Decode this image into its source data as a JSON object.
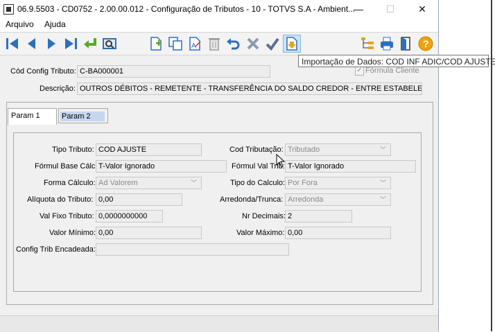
{
  "window": {
    "title": "06.9.5503 - CD0752 - 2.00.00.012 - Configuração de Tributos - 10 - TOTVS S.A - Ambient...",
    "min_symbol": "—",
    "max_symbol": "☐",
    "close_symbol": "✕"
  },
  "menu": {
    "items": [
      "Arquivo",
      "Ajuda"
    ]
  },
  "toolbar": {
    "icons": [
      "first-icon",
      "prev-icon",
      "next-icon",
      "last-icon",
      "goto-icon",
      "search-icon",
      "new-icon",
      "copy-icon",
      "edit-icon",
      "delete-icon",
      "undo-icon",
      "cancel-icon",
      "save-icon",
      "import-icon",
      "tree-icon",
      "print-icon",
      "exit-icon",
      "help-icon"
    ],
    "tooltip": "Importação de Dados: COD INF ADIC/COD AJUSTE"
  },
  "header": {
    "cod_label": "Cód Config Tributo:",
    "cod_value": "C-BA000001",
    "formula_label": "Fórmula Cliente",
    "desc_label": "Descrição:",
    "desc_value": "OUTROS DÉBITOS - REMETENTE - TRANSFERÊNCIA DO SALDO CREDOR - ENTRE ESTABELECIMENTOS"
  },
  "tabs": [
    "Param 1",
    "Param 2"
  ],
  "form": {
    "tipo_tributo_label": "Tipo Tributo:",
    "tipo_tributo_value": "COD AJUSTE",
    "cod_trib_label": "Cod Tributação:",
    "cod_trib_value": "Tributado",
    "form_base_label": "Fórmul Base Cálc:",
    "form_base_value": "T-Valor Ignorado",
    "form_val_label": "Fórmul Val Trib:",
    "form_val_value": "T-Valor Ignorado",
    "forma_calc_label": "Forma Cálculo:",
    "forma_calc_value": "Ad Valorem",
    "tipo_calc_label": "Tipo do Calculo:",
    "tipo_calc_value": "Por Fora",
    "aliquota_label": "Alíquota do Tributo:",
    "aliquota_value": "0,00",
    "arredonda_label": "Arredonda/Trunca:",
    "arredonda_value": "Arredonda",
    "val_fixo_label": "Val Fixo Tributo:",
    "val_fixo_value": "0,0000000000",
    "nr_decimais_label": "Nr Decimais:",
    "nr_decimais_value": "2",
    "valor_min_label": "Valor Mínimo:",
    "valor_min_value": "0,00",
    "valor_max_label": "Valor Máximo:",
    "valor_max_value": "0,00",
    "config_enc_label": "Config Trib Encadeada:",
    "config_enc_value": ""
  }
}
